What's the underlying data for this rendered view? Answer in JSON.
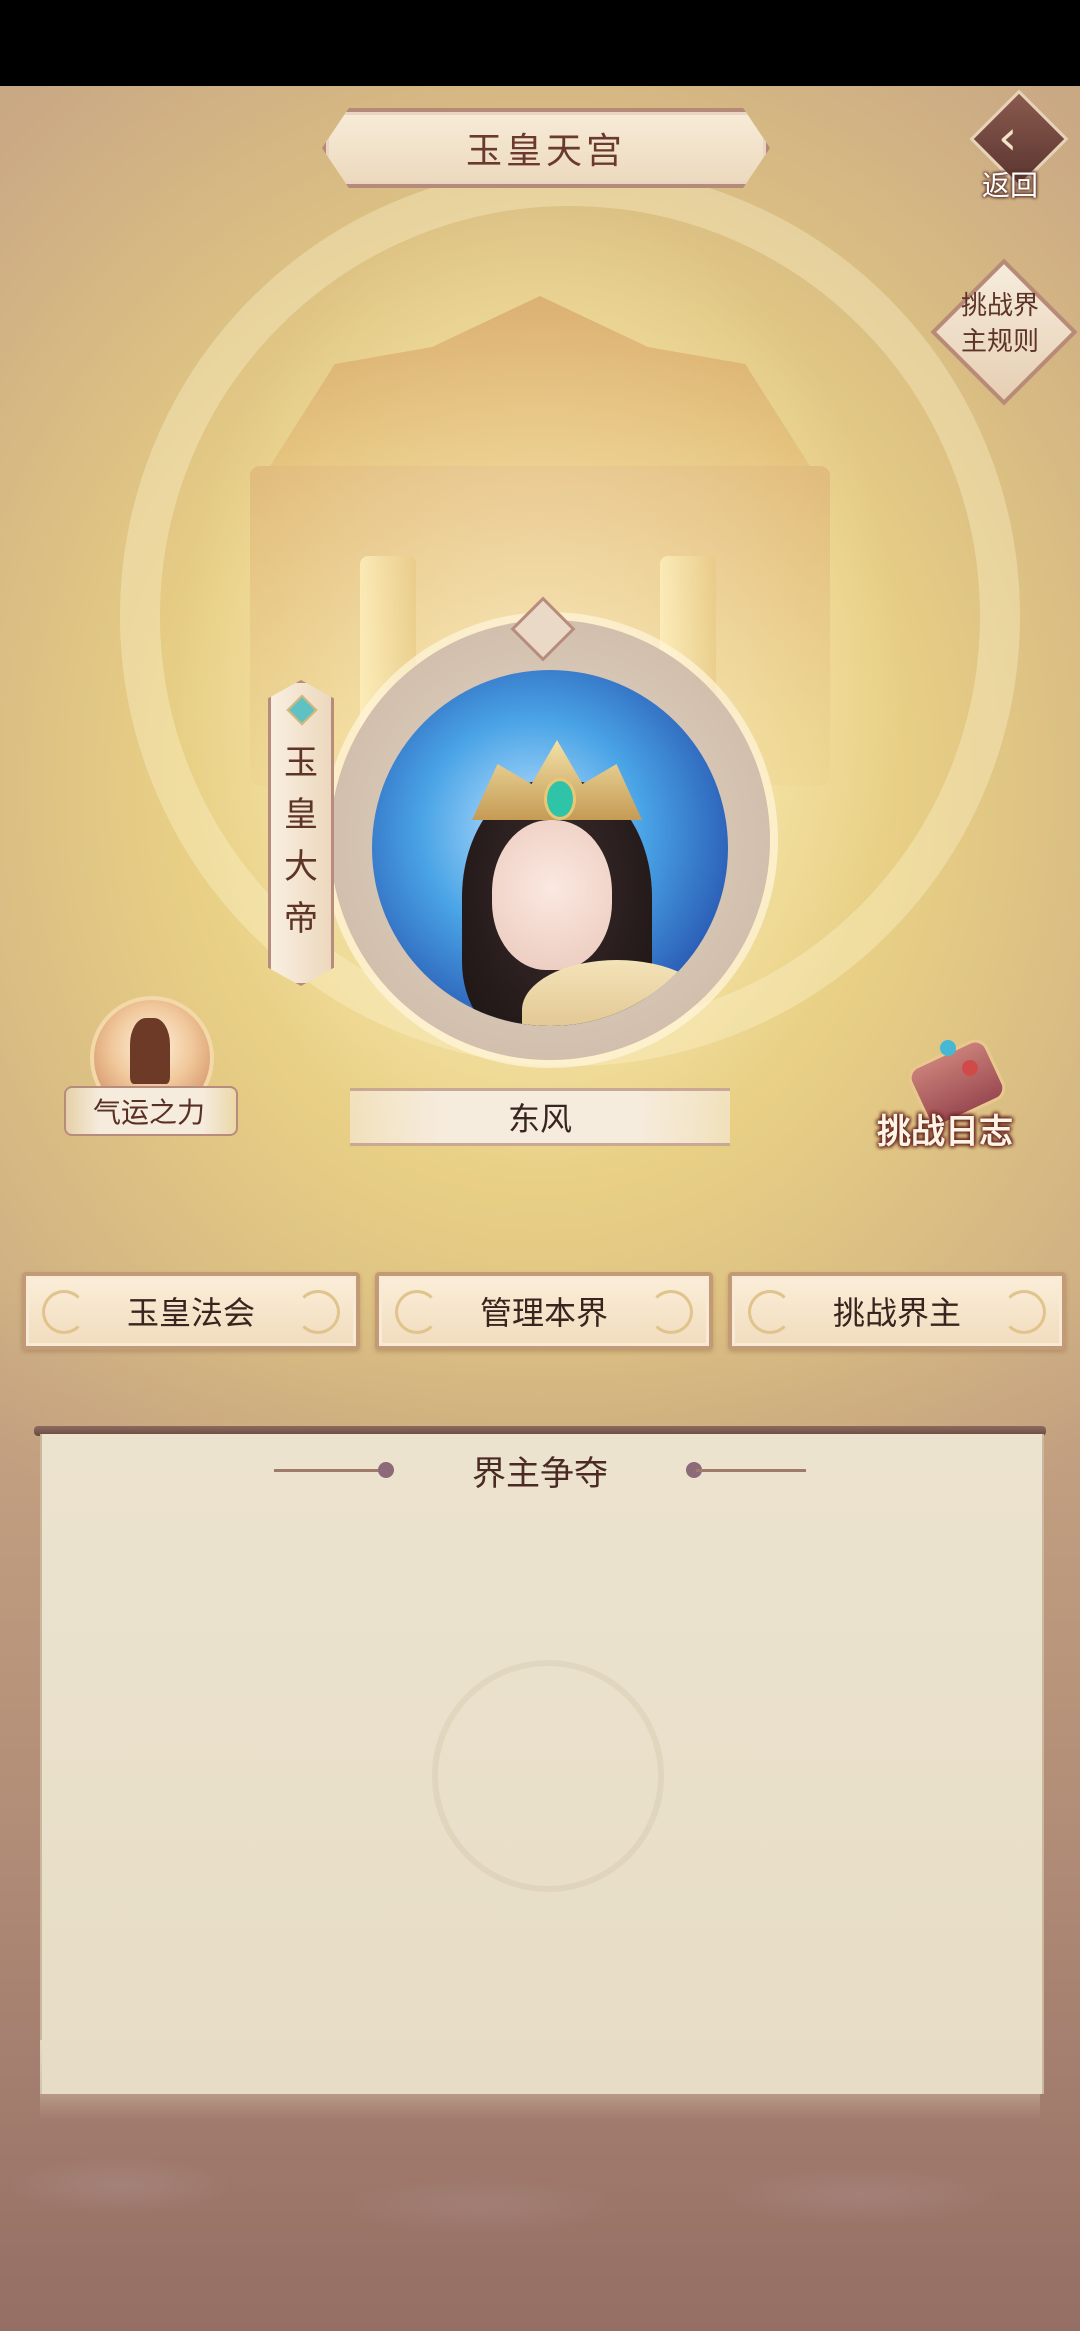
{
  "header": {
    "title": "玉皇天宫",
    "back_label": "返回"
  },
  "rules": {
    "label_line1": "挑战界",
    "label_line2": "主规则"
  },
  "ruler": {
    "rank_title": "玉皇大帝",
    "name": "东风"
  },
  "side": {
    "fortune_label": "气运之力",
    "log_label": "挑战日志"
  },
  "actions": [
    {
      "label": "玉皇法会"
    },
    {
      "label": "管理本界"
    },
    {
      "label": "挑战界主"
    }
  ],
  "panel": {
    "title": "界主争夺"
  },
  "colors": {
    "accent": "#6b3a2e",
    "button_border": "#c39a76",
    "panel_bg": "#ece3cf"
  },
  "icons": {
    "back": "back-arrow-icon",
    "fortune": "fortune-power-icon",
    "log": "scroll-icon"
  }
}
